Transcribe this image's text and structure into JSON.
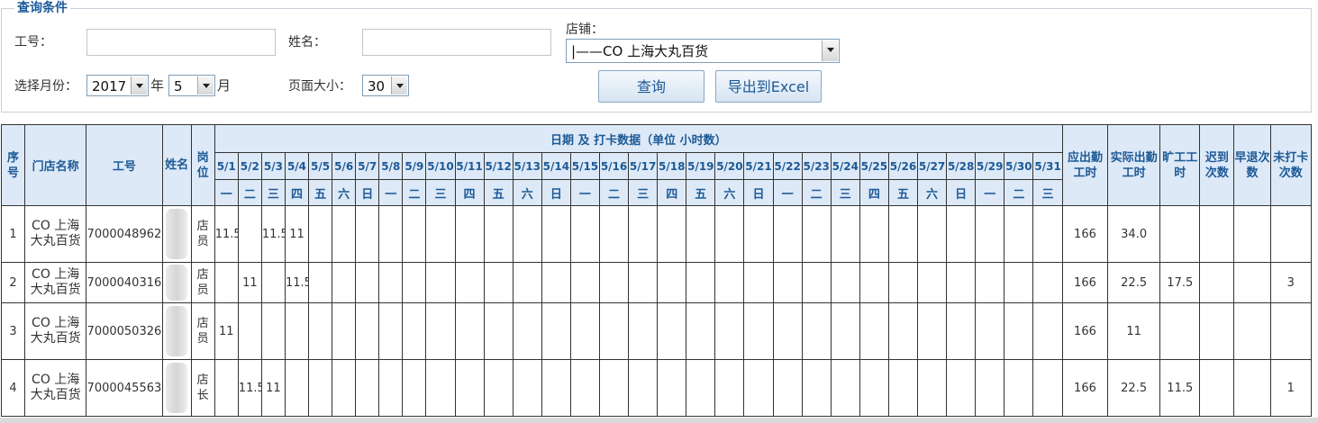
{
  "query": {
    "legend": "查询条件",
    "emp_label": "工号：",
    "emp_value": "",
    "name_label": "姓名：",
    "name_value": "",
    "store_label": "店铺：",
    "store_value": "|——CO 上海大丸百货",
    "month_label": "选择月份：",
    "year_value": "2017",
    "year_unit": "年",
    "month_value": "5",
    "month_unit": "月",
    "pagesize_label": "页面大小：",
    "pagesize_value": "30",
    "search_btn": "查询",
    "export_btn": "导出到Excel"
  },
  "table": {
    "headers": {
      "seq": "序号",
      "store": "门店名称",
      "emp": "工号",
      "name": "姓名",
      "post": "岗位",
      "date_group": "日期 及 打卡数据（单位 小时数）",
      "expected": "应出勤工时",
      "actual": "实际出勤工时",
      "absent": "旷工工时",
      "late": "迟到次数",
      "early": "早退次数",
      "missed": "未打卡次数"
    },
    "dates": [
      "5/1",
      "5/2",
      "5/3",
      "5/4",
      "5/5",
      "5/6",
      "5/7",
      "5/8",
      "5/9",
      "5/10",
      "5/11",
      "5/12",
      "5/13",
      "5/14",
      "5/15",
      "5/16",
      "5/17",
      "5/18",
      "5/19",
      "5/20",
      "5/21",
      "5/22",
      "5/23",
      "5/24",
      "5/25",
      "5/26",
      "5/27",
      "5/28",
      "5/29",
      "5/30",
      "5/31"
    ],
    "weekdays": [
      "一",
      "二",
      "三",
      "四",
      "五",
      "六",
      "日",
      "一",
      "二",
      "三",
      "四",
      "五",
      "六",
      "日",
      "一",
      "二",
      "三",
      "四",
      "五",
      "六",
      "日",
      "一",
      "二",
      "三",
      "四",
      "五",
      "六",
      "日",
      "一",
      "二",
      "三"
    ],
    "rows": [
      {
        "seq": "1",
        "store": "CO 上海大丸百货",
        "emp": "7000048962",
        "post": "店员",
        "days": [
          "11.5",
          "",
          "11.5",
          "11",
          "",
          "",
          "",
          "",
          "",
          "",
          "",
          "",
          "",
          "",
          "",
          "",
          "",
          "",
          "",
          "",
          "",
          "",
          "",
          "",
          "",
          "",
          "",
          "",
          "",
          "",
          ""
        ],
        "expected": "166",
        "actual": "34.0",
        "absent": "",
        "late": "",
        "early": "",
        "missed": ""
      },
      {
        "seq": "2",
        "store": "CO 上海大丸百货",
        "emp": "7000040316",
        "post": "店员",
        "days": [
          "",
          "11",
          "",
          "11.5",
          "",
          "",
          "",
          "",
          "",
          "",
          "",
          "",
          "",
          "",
          "",
          "",
          "",
          "",
          "",
          "",
          "",
          "",
          "",
          "",
          "",
          "",
          "",
          "",
          "",
          "",
          ""
        ],
        "expected": "166",
        "actual": "22.5",
        "absent": "17.5",
        "late": "",
        "early": "",
        "missed": "3"
      },
      {
        "seq": "3",
        "store": "CO 上海大丸百货",
        "emp": "7000050326",
        "post": "店员",
        "days": [
          "11",
          "",
          "",
          "",
          "",
          "",
          "",
          "",
          "",
          "",
          "",
          "",
          "",
          "",
          "",
          "",
          "",
          "",
          "",
          "",
          "",
          "",
          "",
          "",
          "",
          "",
          "",
          "",
          "",
          "",
          ""
        ],
        "expected": "166",
        "actual": "11",
        "absent": "",
        "late": "",
        "early": "",
        "missed": ""
      },
      {
        "seq": "4",
        "store": "CO 上海大丸百货",
        "emp": "7000045563",
        "post": "店长",
        "days": [
          "",
          "11.5",
          "11",
          "",
          "",
          "",
          "",
          "",
          "",
          "",
          "",
          "",
          "",
          "",
          "",
          "",
          "",
          "",
          "",
          "",
          "",
          "",
          "",
          "",
          "",
          "",
          "",
          "",
          "",
          "",
          ""
        ],
        "expected": "166",
        "actual": "22.5",
        "absent": "11.5",
        "late": "",
        "early": "",
        "missed": "1"
      }
    ]
  }
}
